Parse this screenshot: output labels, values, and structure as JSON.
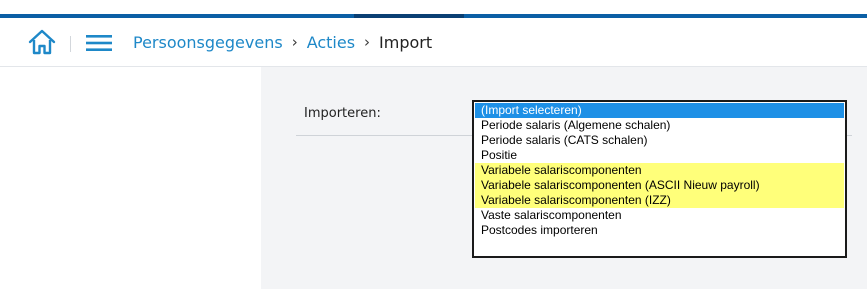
{
  "colors": {
    "stripe_primary": "#0b5fa5",
    "stripe_dark": "#0a3f73",
    "link": "#1e88c8",
    "selected_option": "#1e90e6",
    "highlight": "#ffff7a",
    "content_bg": "#f3f4f6"
  },
  "nav": {
    "home_icon": "home-icon",
    "menu_icon": "hamburger-menu-icon",
    "breadcrumb": [
      {
        "label": "Persoonsgegevens"
      },
      {
        "label": "Acties"
      },
      {
        "label": "Import"
      }
    ],
    "separator": "›"
  },
  "form": {
    "import_label": "Importeren:",
    "options": [
      {
        "label": "(Import selecteren)",
        "selected": true,
        "highlighted": false
      },
      {
        "label": "Periode salaris (Algemene schalen)",
        "selected": false,
        "highlighted": false
      },
      {
        "label": "Periode salaris (CATS schalen)",
        "selected": false,
        "highlighted": false
      },
      {
        "label": "Positie",
        "selected": false,
        "highlighted": false
      },
      {
        "label": "Variabele salariscomponenten",
        "selected": false,
        "highlighted": true
      },
      {
        "label": "Variabele salariscomponenten (ASCII Nieuw payroll)",
        "selected": false,
        "highlighted": true
      },
      {
        "label": "Variabele salariscomponenten (IZZ)",
        "selected": false,
        "highlighted": true
      },
      {
        "label": "Vaste salariscomponenten",
        "selected": false,
        "highlighted": false
      },
      {
        "label": "Postcodes importeren",
        "selected": false,
        "highlighted": false
      }
    ]
  }
}
